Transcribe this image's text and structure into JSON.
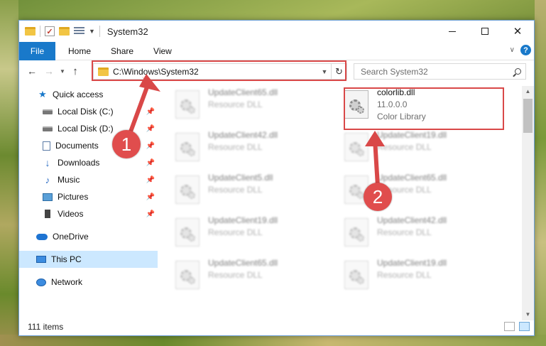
{
  "window": {
    "title": "System32"
  },
  "ribbon": {
    "tabs": [
      "File",
      "Home",
      "Share",
      "View"
    ]
  },
  "address": {
    "path": "C:\\Windows\\System32",
    "search_placeholder": "Search System32"
  },
  "sidebar": {
    "items": [
      {
        "label": "Quick access",
        "icon": "star-icon",
        "pinned": false
      },
      {
        "label": "Local Disk (C:)",
        "icon": "drive-icon",
        "pinned": true
      },
      {
        "label": "Local Disk (D:)",
        "icon": "drive-icon",
        "pinned": true
      },
      {
        "label": "Documents",
        "icon": "documents-icon",
        "pinned": true
      },
      {
        "label": "Downloads",
        "icon": "download-icon",
        "pinned": true
      },
      {
        "label": "Music",
        "icon": "music-icon",
        "pinned": true
      },
      {
        "label": "Pictures",
        "icon": "pictures-icon",
        "pinned": true
      },
      {
        "label": "Videos",
        "icon": "videos-icon",
        "pinned": true
      },
      {
        "label": "OneDrive",
        "icon": "cloud-icon",
        "pinned": false
      },
      {
        "label": "This PC",
        "icon": "computer-icon",
        "pinned": false,
        "selected": true
      },
      {
        "label": "Network",
        "icon": "network-icon",
        "pinned": false
      }
    ]
  },
  "files": {
    "highlighted": {
      "name": "colorlib.dll",
      "version": "11.0.0.0",
      "description": "Color Library"
    },
    "left_column": [
      {
        "name": "UpdateClient65.dll",
        "description": "Resource DLL"
      },
      {
        "name": "UpdateClient42.dll",
        "description": "Resource DLL"
      },
      {
        "name": "UpdateClient5.dll",
        "description": "Resource DLL"
      },
      {
        "name": "UpdateClient19.dll",
        "description": "Resource DLL"
      },
      {
        "name": "UpdateClient65.dll",
        "description": "Resource DLL"
      }
    ],
    "right_column": [
      {
        "name": "UpdateClient19.dll",
        "description": "Resource DLL"
      },
      {
        "name": "UpdateClient65.dll",
        "description": "Resource DLL"
      },
      {
        "name": "UpdateClient42.dll",
        "description": "Resource DLL"
      },
      {
        "name": "UpdateClient19.dll",
        "description": "Resource DLL"
      }
    ]
  },
  "status": {
    "item_count": "111 items"
  },
  "annotations": {
    "callout_1": "1",
    "callout_2": "2",
    "color": "#d94848"
  }
}
